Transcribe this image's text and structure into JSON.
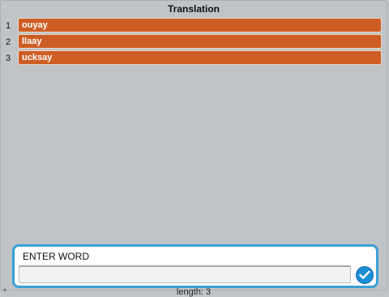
{
  "title": "Translation",
  "rows": [
    {
      "index": "1",
      "value": "ouyay"
    },
    {
      "index": "2",
      "value": "llaay"
    },
    {
      "index": "3",
      "value": "ucksay"
    }
  ],
  "prompt": {
    "label": "ENTER WORD",
    "value": "",
    "submit_icon": "check-icon"
  },
  "footer": {
    "length_text": "length: 3",
    "resize_icon": "plus-icon"
  },
  "colors": {
    "cell": "#ce5d24",
    "accent": "#3a9fd6",
    "background": "#c1c4c7"
  }
}
